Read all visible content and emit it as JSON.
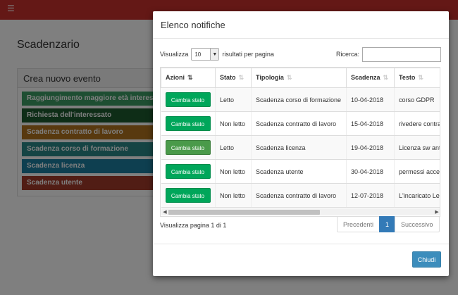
{
  "background": {
    "menu_icon": "☰",
    "page_title": "Scadenzario",
    "panel_title": "Crea nuovo evento",
    "events": [
      {
        "label": "Raggiungimento maggiore età interessato",
        "color": "#3c9c64"
      },
      {
        "label": "Richiesta dell'interessato",
        "color": "#1d5a2e"
      },
      {
        "label": "Scadenza contratto di lavoro",
        "color": "#b0721f"
      },
      {
        "label": "Scadenza corso di formazione",
        "color": "#2a8888"
      },
      {
        "label": "Scadenza licenza",
        "color": "#1c7fa0"
      },
      {
        "label": "Scadenza utente",
        "color": "#a33b2b"
      }
    ]
  },
  "modal": {
    "title": "Elenco notifiche",
    "length_prefix": "Visualizza",
    "length_value": "10",
    "length_suffix": "risultati per pagina",
    "search_label": "Ricerca:",
    "search_value": "",
    "columns": [
      "Azioni",
      "Stato",
      "Tipologia",
      "Scadenza",
      "Testo"
    ],
    "button_label": "Cambia stato",
    "rows": [
      {
        "stato": "Letto",
        "tipologia": "Scadenza corso di formazione",
        "scadenza": "10-04-2018",
        "testo": "corso GDPR"
      },
      {
        "stato": "Non letto",
        "tipologia": "Scadenza contratto di lavoro",
        "scadenza": "15-04-2018",
        "testo": "rivedere contratto"
      },
      {
        "stato": "Letto",
        "tipologia": "Scadenza licenza",
        "scadenza": "19-04-2018",
        "testo": "Licenza sw antivirus"
      },
      {
        "stato": "Non letto",
        "tipologia": "Scadenza utente",
        "scadenza": "30-04-2018",
        "testo": "permessi accesso"
      },
      {
        "stato": "Non letto",
        "tipologia": "Scadenza contratto di lavoro",
        "scadenza": "12-07-2018",
        "testo": "L'incaricato Leo"
      }
    ],
    "page_info": "Visualizza pagina 1 di 1",
    "pagination": {
      "prev": "Precedenti",
      "current": "1",
      "next": "Successivo"
    },
    "close_label": "Chiudi"
  }
}
